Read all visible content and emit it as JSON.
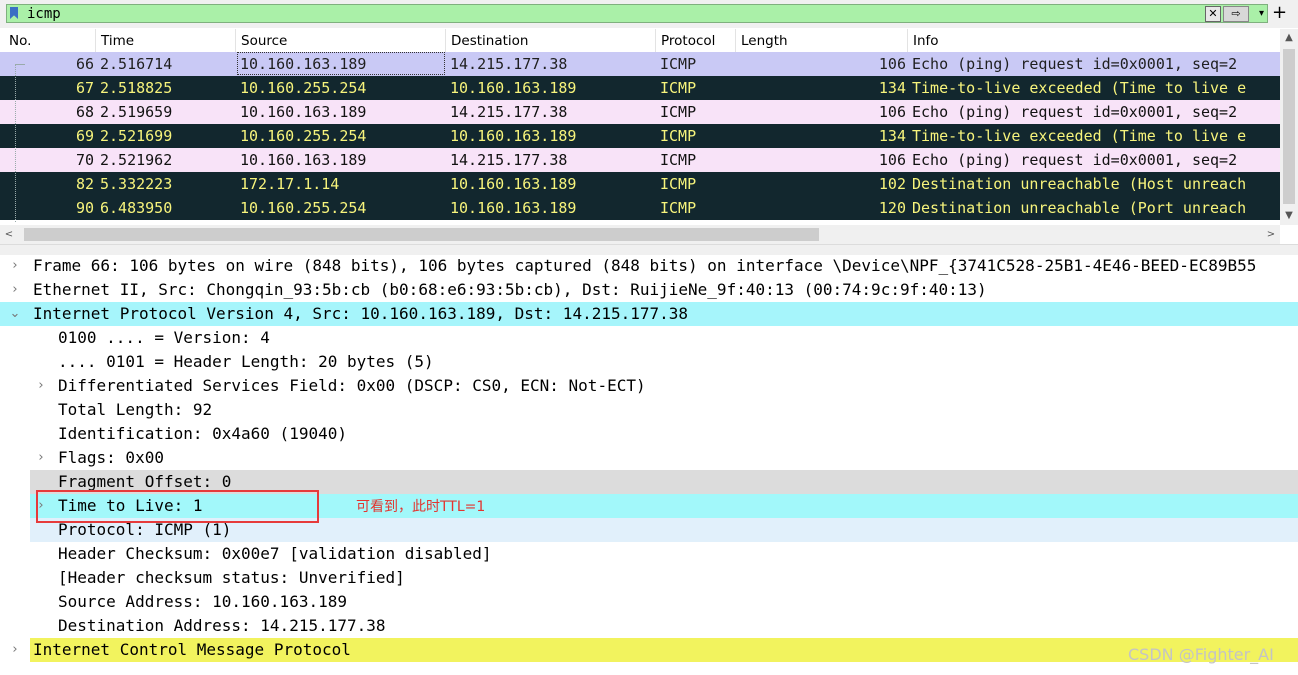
{
  "filter": {
    "value": "icmp",
    "clear_icon": "✕",
    "apply_icon": "⇨",
    "dropdown_icon": "▾",
    "add_icon": "+"
  },
  "columns": [
    "No.",
    "Time",
    "Source",
    "Destination",
    "Protocol",
    "Length",
    "Info"
  ],
  "packets": [
    {
      "no": "66",
      "time": "2.516714",
      "src": "10.160.163.189",
      "dst": "14.215.177.38",
      "proto": "ICMP",
      "len": "106",
      "info": "Echo (ping) request  id=0x0001, seq=2",
      "style": "sel"
    },
    {
      "no": "67",
      "time": "2.518825",
      "src": "10.160.255.254",
      "dst": "10.160.163.189",
      "proto": "ICMP",
      "len": "134",
      "info": "Time-to-live exceeded (Time to live e",
      "style": "err"
    },
    {
      "no": "68",
      "time": "2.519659",
      "src": "10.160.163.189",
      "dst": "14.215.177.38",
      "proto": "ICMP",
      "len": "106",
      "info": "Echo (ping) request  id=0x0001, seq=2",
      "style": "echo"
    },
    {
      "no": "69",
      "time": "2.521699",
      "src": "10.160.255.254",
      "dst": "10.160.163.189",
      "proto": "ICMP",
      "len": "134",
      "info": "Time-to-live exceeded (Time to live e",
      "style": "err"
    },
    {
      "no": "70",
      "time": "2.521962",
      "src": "10.160.163.189",
      "dst": "14.215.177.38",
      "proto": "ICMP",
      "len": "106",
      "info": "Echo (ping) request  id=0x0001, seq=2",
      "style": "echo"
    },
    {
      "no": "82",
      "time": "5.332223",
      "src": "172.17.1.14",
      "dst": "10.160.163.189",
      "proto": "ICMP",
      "len": "102",
      "info": "Destination unreachable (Host unreach",
      "style": "err"
    },
    {
      "no": "90",
      "time": "6.483950",
      "src": "10.160.255.254",
      "dst": "10.160.163.189",
      "proto": "ICMP",
      "len": "120",
      "info": "Destination unreachable (Port unreach",
      "style": "err"
    }
  ],
  "details": {
    "frame": "Frame 66: 106 bytes on wire (848 bits), 106 bytes captured (848 bits) on interface \\Device\\NPF_{3741C528-25B1-4E46-BEED-EC89B55",
    "ethernet": "Ethernet II, Src: Chongqin_93:5b:cb (b0:68:e6:93:5b:cb), Dst: RuijieNe_9f:40:13 (00:74:9c:9f:40:13)",
    "ip": "Internet Protocol Version 4, Src: 10.160.163.189, Dst: 14.215.177.38",
    "version": "0100 .... = Version: 4",
    "header_length": ".... 0101 = Header Length: 20 bytes (5)",
    "dsfield": "Differentiated Services Field: 0x00 (DSCP: CS0, ECN: Not-ECT)",
    "total_length": "Total Length: 92",
    "identification": "Identification: 0x4a60 (19040)",
    "flags": "Flags: 0x00",
    "fragment_offset": "Fragment Offset: 0",
    "ttl": "Time to Live: 1",
    "protocol": "Protocol: ICMP (1)",
    "checksum": "Header Checksum: 0x00e7 [validation disabled]",
    "checksum_status": "[Header checksum status: Unverified]",
    "source_address": "Source Address: 10.160.163.189",
    "destination_address": "Destination Address: 14.215.177.38",
    "icmp": "Internet Control Message Protocol"
  },
  "annotation": {
    "note": "可看到，此时TTL=1",
    "color": "#e63b3b"
  },
  "watermark": "CSDN @Fighter_AI",
  "icons": {
    "collapsed": "›",
    "expanded": "⌄",
    "scroll_up": "▲",
    "scroll_down": "▼",
    "scroll_left": "<",
    "scroll_right": ">"
  }
}
